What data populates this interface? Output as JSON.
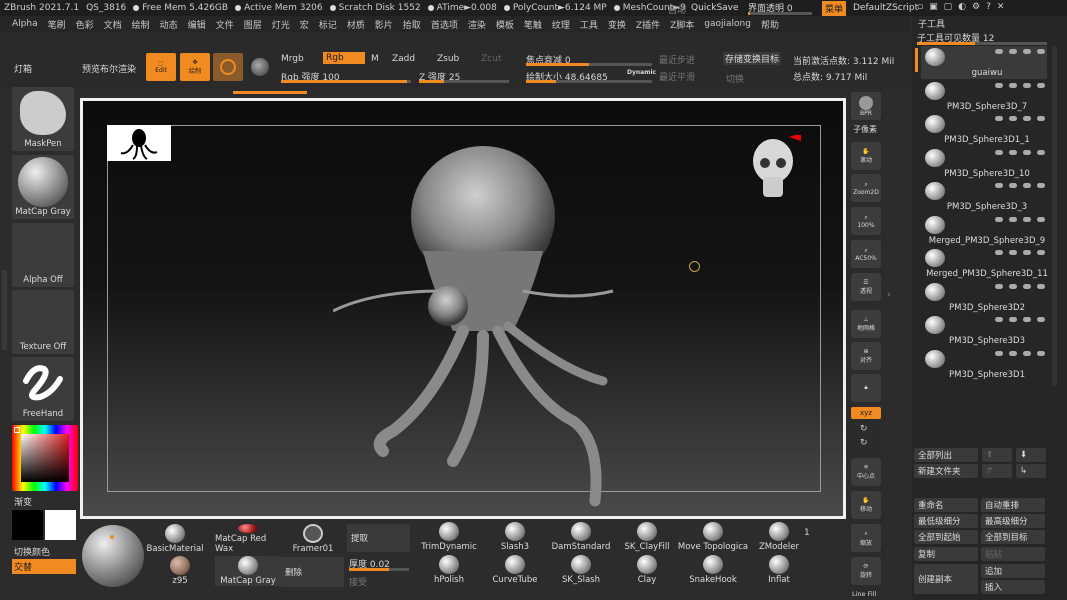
{
  "topbar": {
    "app": "ZBrush 2021.7.1",
    "project": "QS_3816",
    "free_mem": "Free Mem 5.426GB",
    "active_mem": "Active Mem 3206",
    "scratch": "Scratch Disk 1552",
    "atime": "ATime►0.008",
    "polycount": "PolyCount►6.124 MP",
    "meshcount": "MeshCount►9",
    "auto": "自动",
    "quicksave": "QuickSave",
    "transparency": "界面透明 0",
    "menu": "菜单",
    "script": "DefaultZScript"
  },
  "menus": [
    "Alpha",
    "笔刷",
    "色彩",
    "文档",
    "绘制",
    "动态",
    "编辑",
    "文件",
    "图层",
    "灯光",
    "宏",
    "标记",
    "材质",
    "影片",
    "拾取",
    "首选项",
    "渲染",
    "模板",
    "笔触",
    "纹理",
    "工具",
    "变换",
    "Z插件",
    "Z脚本",
    "gaojialong",
    "帮助"
  ],
  "toolbar": {
    "lightbox": "灯箱",
    "preview": "预览布尔渲染",
    "edit": "Edit",
    "draw": "绘制",
    "mrgb": "Mrgb",
    "rgb": "Rgb",
    "m": "M",
    "zadd": "Zadd",
    "zsub": "Zsub",
    "zcut": "Zcut",
    "rgb_strength": "Rgb 强度 100",
    "z_strength": "Z 强度 25",
    "focal": "焦点衰减 0",
    "draw_size": "绘制大小 48.64685",
    "dynamic": "Dynamic",
    "undo_steps": "最近步进",
    "recent_smooth": "最近平滑",
    "store_target": "存储变换目标",
    "switch": "切换",
    "active_points": "当前激活点数: 3.112 Mil",
    "total_points": "总点数: 9.717 Mil"
  },
  "left": {
    "maskpen": "MaskPen",
    "matcap": "MatCap Gray",
    "alpha": "Alpha Off",
    "texture": "Texture Off",
    "freehand": "FreeHand",
    "gradient": "渐变",
    "switch_color": "切换颜色",
    "alternate": "交替"
  },
  "right_tools": {
    "bpr": "BPR",
    "subpixel": "子像素",
    "scroll": "滚动",
    "zoom2d": "Zoom2D",
    "p100": "100%",
    "ac50": "AC50%",
    "persp": "透视",
    "floor": "地网格",
    "local": "对齐",
    "xyz": "xyz",
    "center": "中心点",
    "move": "移动",
    "scale": "缩放",
    "rotate": "旋转",
    "linefill": "Line Fill"
  },
  "bottom": {
    "materials": [
      "BasicMaterial",
      "MatCap Red Wax",
      "Framer01",
      "z95",
      "MatCap Gray"
    ],
    "extract": "提取",
    "delete": "删除",
    "thickness": "厚度 0.02",
    "accept": "接受",
    "brushes_top": [
      "TrimDynamic",
      "Slash3",
      "DamStandard",
      "SK_ClayFill",
      "Move Topologica",
      "ZModeler"
    ],
    "brushes_bottom": [
      "hPolish",
      "CurveTube",
      "SK_Slash",
      "Clay",
      "SnakeHook",
      "Inflat"
    ],
    "num": "1"
  },
  "subtool": {
    "header": "子工具",
    "visible": "子工具可见数量 12",
    "items": [
      "guaiwu",
      "PM3D_Sphere3D_7",
      "PM3D_Sphere3D1_1",
      "PM3D_Sphere3D_10",
      "PM3D_Sphere3D_3",
      "Merged_PM3D_Sphere3D_9",
      "Merged_PM3D_Sphere3D_11",
      "PM3D_Sphere3D2",
      "PM3D_Sphere3D3",
      "PM3D_Sphere3D1"
    ],
    "list_all": "全部列出",
    "new_folder": "新建文件夹",
    "rename": "重命名",
    "auto_reorder": "自动重排",
    "lowest": "最低级细分",
    "highest": "最高级细分",
    "all_to_start": "全部到起始",
    "all_to_target": "全部到目标",
    "duplicate": "复制",
    "paste": "粘贴",
    "append": "追加",
    "create_copy": "创建副本",
    "insert": "插入"
  },
  "colors": {
    "accent": "#f18a20"
  }
}
